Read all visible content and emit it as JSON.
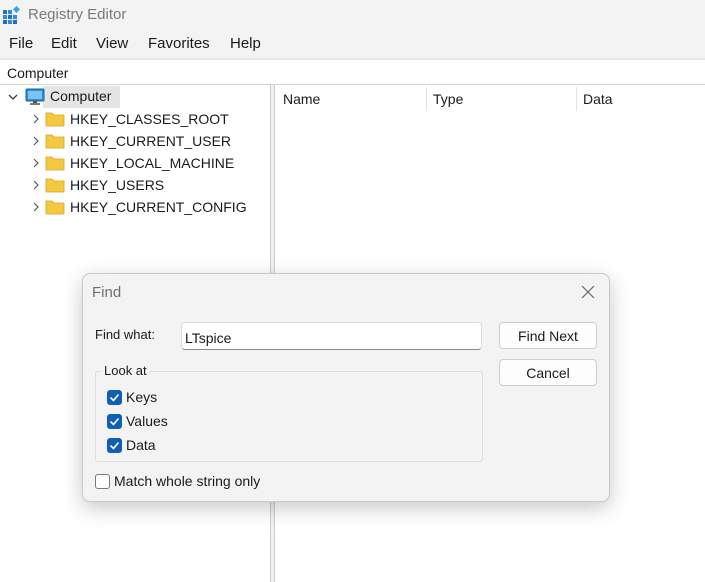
{
  "window": {
    "title": "Registry Editor"
  },
  "menu": [
    "File",
    "Edit",
    "View",
    "Favorites",
    "Help"
  ],
  "address": "Computer",
  "tree": {
    "root": "Computer",
    "items": [
      {
        "label": "HKEY_CLASSES_ROOT"
      },
      {
        "label": "HKEY_CURRENT_USER"
      },
      {
        "label": "HKEY_LOCAL_MACHINE"
      },
      {
        "label": "HKEY_USERS"
      },
      {
        "label": "HKEY_CURRENT_CONFIG"
      }
    ]
  },
  "columns": [
    "Name",
    "Type",
    "Data"
  ],
  "find_dialog": {
    "title": "Find",
    "find_what_label": "Find what:",
    "find_what_value": "LTspice",
    "find_next_label": "Find Next",
    "cancel_label": "Cancel",
    "look_at_label": "Look at",
    "options": [
      {
        "label": "Keys",
        "checked": true
      },
      {
        "label": "Values",
        "checked": true
      },
      {
        "label": "Data",
        "checked": true
      }
    ],
    "match_whole_label": "Match whole string only",
    "match_whole_checked": false
  },
  "colors": {
    "accent": "#0f5fb5",
    "folder": "#f5c842",
    "window_bg": "#f3f3f3"
  },
  "icons": {
    "app": "registry-editor-icon",
    "root": "computer-icon",
    "key": "folder-icon",
    "close": "close-icon",
    "expand": "chevron-right-icon",
    "collapse": "chevron-down-icon",
    "check": "checkmark-icon"
  }
}
